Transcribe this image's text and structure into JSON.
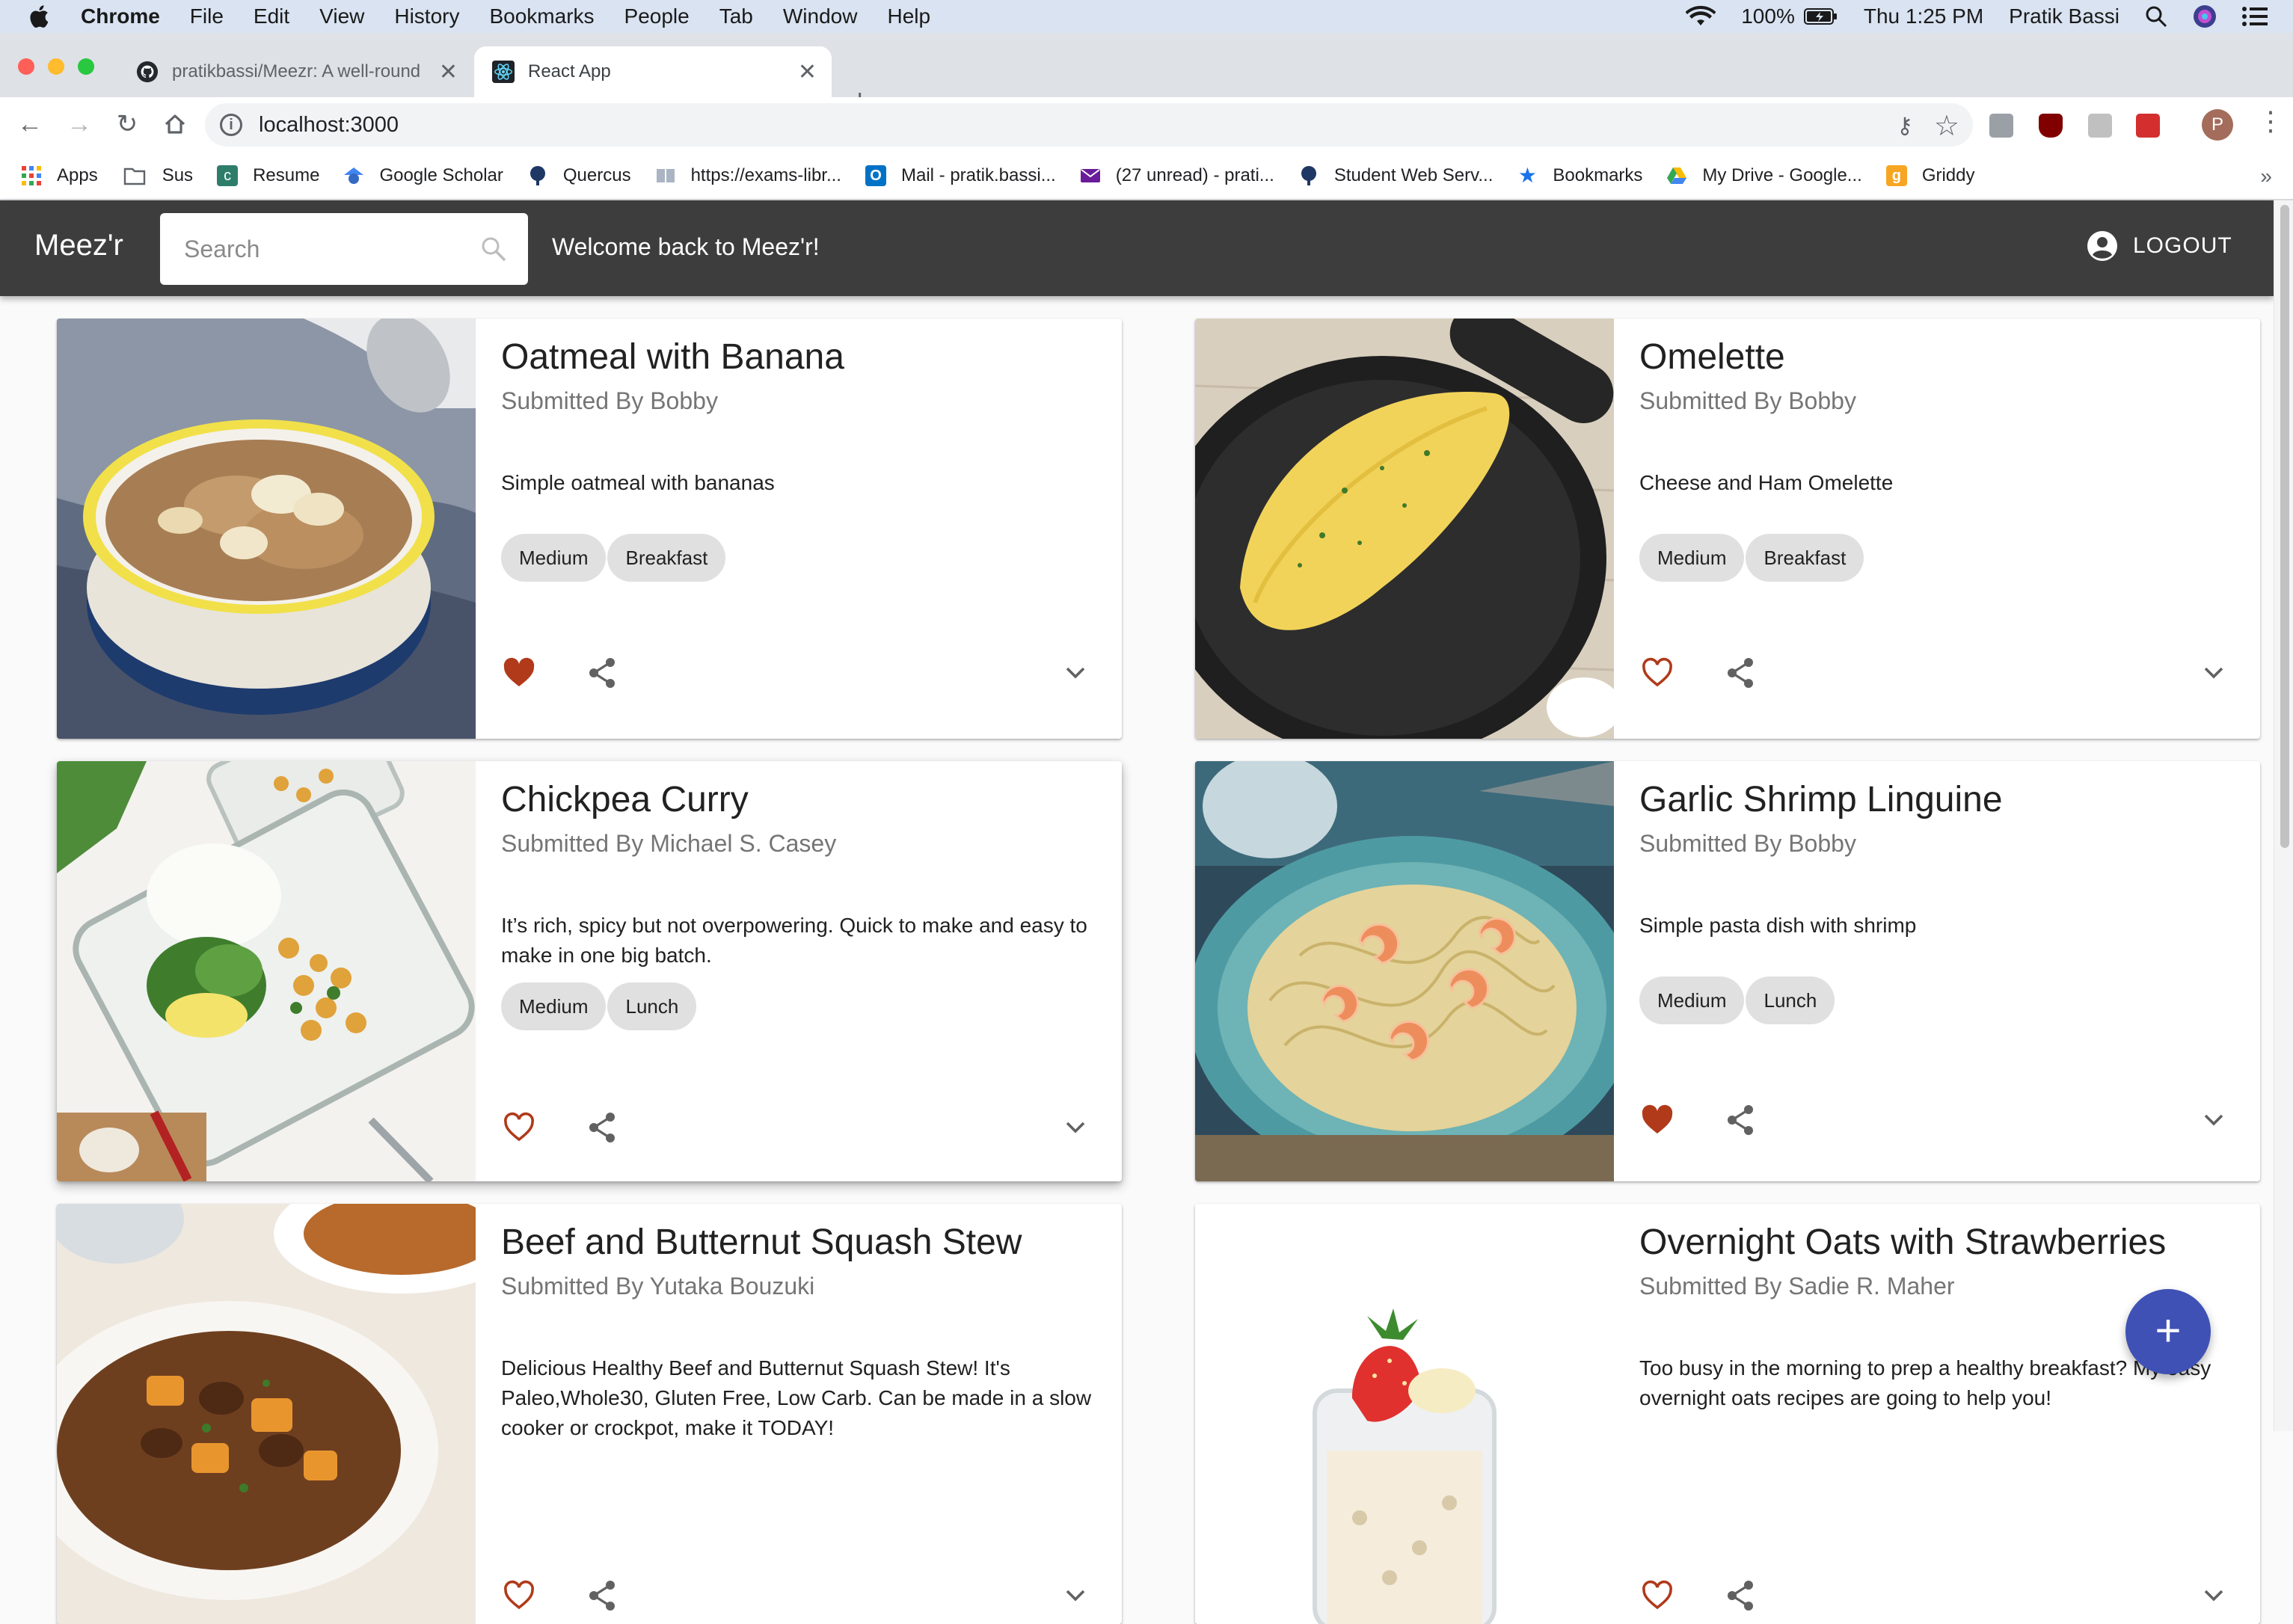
{
  "os_menubar": {
    "app": "Chrome",
    "items": [
      "File",
      "Edit",
      "View",
      "History",
      "Bookmarks",
      "People",
      "Tab",
      "Window",
      "Help"
    ],
    "battery": "100%",
    "clock": "Thu 1:25 PM",
    "user": "Pratik Bassi"
  },
  "tabs": [
    {
      "title": "pratikbassi/Meezr: A well-round",
      "icon": "github-icon"
    },
    {
      "title": "React App",
      "icon": "react-icon"
    }
  ],
  "address_bar": {
    "url": "localhost:3000"
  },
  "bookmarks": [
    "Apps",
    "Sus",
    "Resume",
    "Google Scholar",
    "Quercus",
    "https://exams-libr...",
    "Mail - pratik.bassi...",
    "(27 unread) - prati...",
    "Student Web Serv...",
    "Bookmarks",
    "My Drive - Google...",
    "Griddy"
  ],
  "profile_initial": "P",
  "app": {
    "brand": "Meez'r",
    "search_placeholder": "Search",
    "welcome": "Welcome back to Meez'r!",
    "logout": "LOGOUT",
    "accent": "#3f51b5",
    "header_bg": "#3d3d3d",
    "favorite_color": "#b03a1a"
  },
  "recipes": [
    {
      "title": "Oatmeal with Banana",
      "submitted_by": "Submitted By Bobby",
      "description": "Simple oatmeal with bananas",
      "tags": [
        "Medium",
        "Breakfast"
      ],
      "favorited": true
    },
    {
      "title": "Omelette",
      "submitted_by": "Submitted By Bobby",
      "description": "Cheese and Ham Omelette",
      "tags": [
        "Medium",
        "Breakfast"
      ],
      "favorited": false
    },
    {
      "title": "Chickpea Curry",
      "submitted_by": "Submitted By Michael S. Casey",
      "description": "It’s rich, spicy but not overpowering. Quick to make and easy to make in one big batch.",
      "tags": [
        "Medium",
        "Lunch"
      ],
      "favorited": false
    },
    {
      "title": "Garlic Shrimp Linguine",
      "submitted_by": "Submitted By Bobby",
      "description": "Simple pasta dish with shrimp",
      "tags": [
        "Medium",
        "Lunch"
      ],
      "favorited": true
    },
    {
      "title": "Beef and Butternut Squash Stew",
      "submitted_by": "Submitted By Yutaka Bouzuki",
      "description": "Delicious Healthy Beef and Butternut Squash Stew! It's Paleo,Whole30, Gluten Free, Low Carb. Can be made in a slow cooker or crockpot, make it TODAY!",
      "tags": [],
      "favorited": false
    },
    {
      "title": "Overnight Oats with Strawberries",
      "submitted_by": "Submitted By Sadie R. Maher",
      "description": "Too busy in the morning to prep a healthy breakfast? My easy overnight oats recipes are going to help you!",
      "tags": [],
      "favorited": false
    }
  ],
  "fab_label": "+"
}
